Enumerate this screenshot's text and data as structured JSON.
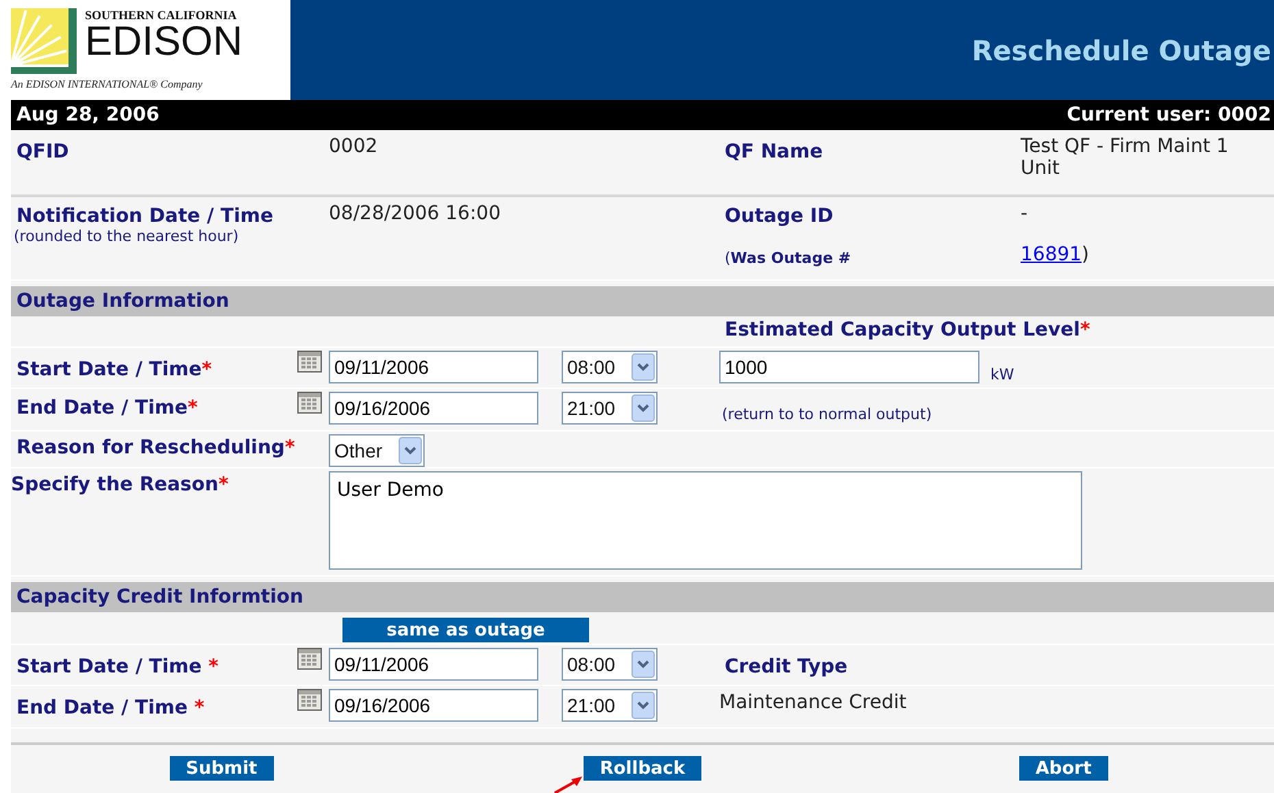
{
  "header": {
    "logo": {
      "top": "SOUTHERN CALIFORNIA",
      "name": "EDISON",
      "tagline": "An EDISON INTERNATIONAL® Company"
    },
    "title": "Reschedule Outage"
  },
  "status_bar": {
    "date": "Aug 28, 2006",
    "user": "Current user: 0002"
  },
  "info": {
    "qfid": {
      "label": "QFID",
      "value": "0002"
    },
    "qf_name": {
      "label": "QF Name",
      "value": "Test QF - Firm Maint 1 Unit"
    },
    "notification": {
      "label": "Notification Date / Time",
      "note": "(rounded to the nearest hour)",
      "value": "08/28/2006 16:00"
    },
    "outage_id": {
      "label": "Outage ID",
      "value": "-"
    },
    "was_outage": {
      "label": "(**Was Outage #**",
      "link": "16891",
      "suffix": ")"
    }
  },
  "outage": {
    "title": "Outage Information",
    "capacity": {
      "label": "Estimated Capacity Output Level",
      "mark": "*",
      "value": "1000",
      "unit": "kW",
      "note": "(return to to normal output)"
    },
    "start": {
      "label": "Start Date / Time",
      "mark": "*",
      "date": "09/11/2006",
      "time": "08:00"
    },
    "end": {
      "label": "End Date / Time",
      "mark": "*",
      "date": "09/16/2006",
      "time": "21:00"
    },
    "reason": {
      "label": "Reason for Rescheduling",
      "mark": "*",
      "value": "Other"
    },
    "specify": {
      "label": "Specify the Reason",
      "mark": "*",
      "value": "User Demo"
    }
  },
  "credit": {
    "title": "Capacity Credit Informtion",
    "same_button": "same as outage",
    "start": {
      "label": "Start Date / Time ",
      "mark": "*",
      "date": "09/11/2006",
      "time": "08:00"
    },
    "end": {
      "label": "End Date / Time ",
      "mark": "*",
      "date": "09/16/2006",
      "time": "21:00"
    },
    "type": {
      "label": "Credit Type",
      "value": "Maintenance Credit"
    }
  },
  "buttons": [
    "Submit",
    "Rollback",
    "Abort"
  ]
}
